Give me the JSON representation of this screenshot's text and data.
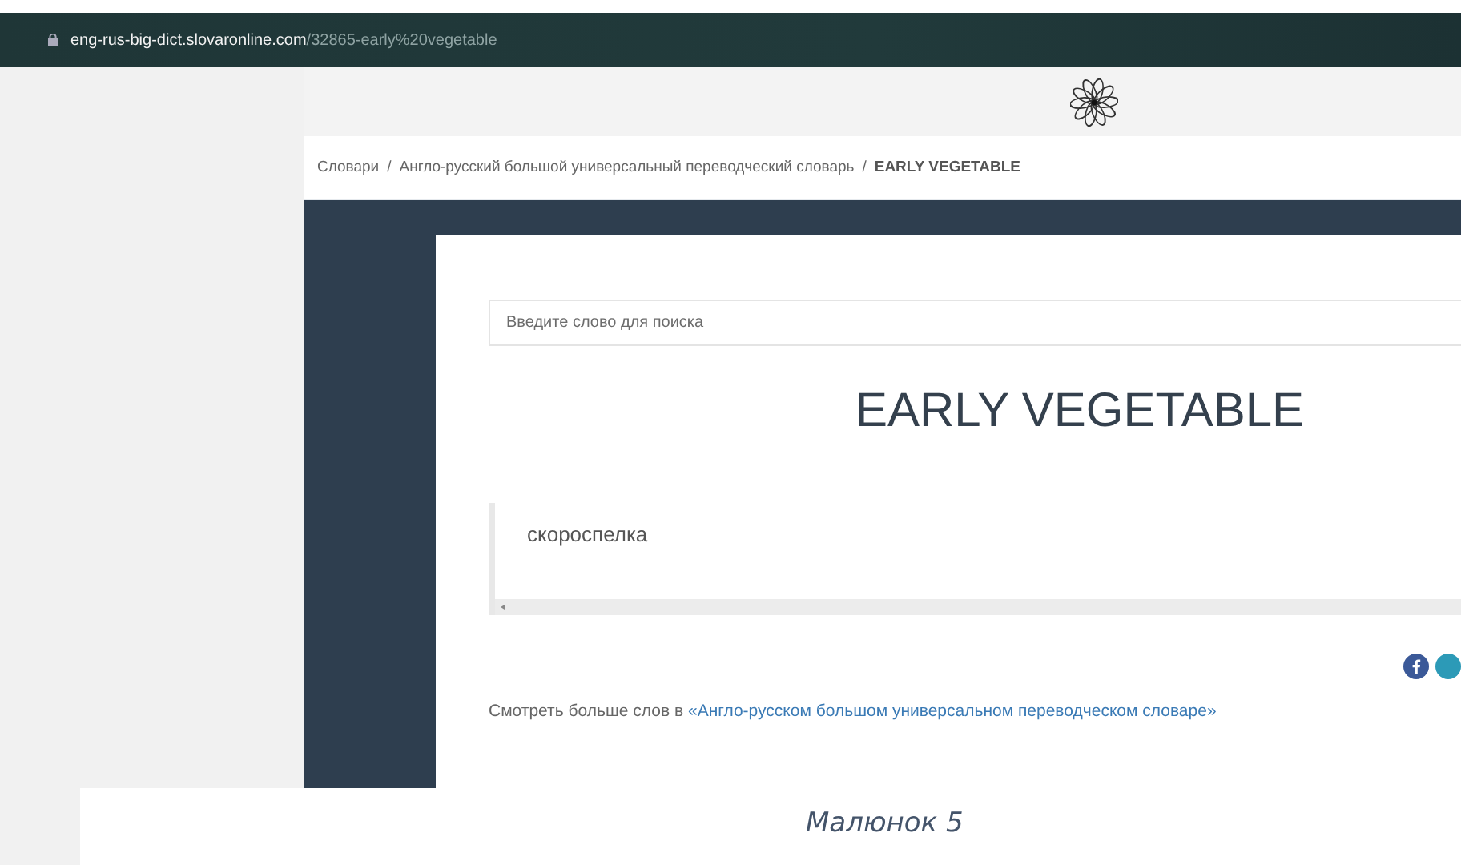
{
  "browser": {
    "url": {
      "domain": "eng-rus-big-dict.slovaronline.com",
      "path": "/32865-early%20vegetable"
    }
  },
  "breadcrumb": [
    {
      "label": "Словари",
      "kind": "link"
    },
    {
      "label": "/",
      "kind": "separator"
    },
    {
      "label": "Англо-русский большой универсальный переводческий словарь",
      "kind": "link"
    },
    {
      "label": "/",
      "kind": "separator"
    },
    {
      "label": "EARLY VEGETABLE",
      "kind": "current"
    }
  ],
  "search": {
    "placeholder": "Введите слово для поиска"
  },
  "entry": {
    "title": "EARLY VEGETABLE",
    "translation": "скороспелка"
  },
  "more_words": {
    "text": "Смотреть больше слов в",
    "link": "«Англо-русском большом универсальном переводческом словаре»"
  },
  "caption": "Малюнок 5"
}
